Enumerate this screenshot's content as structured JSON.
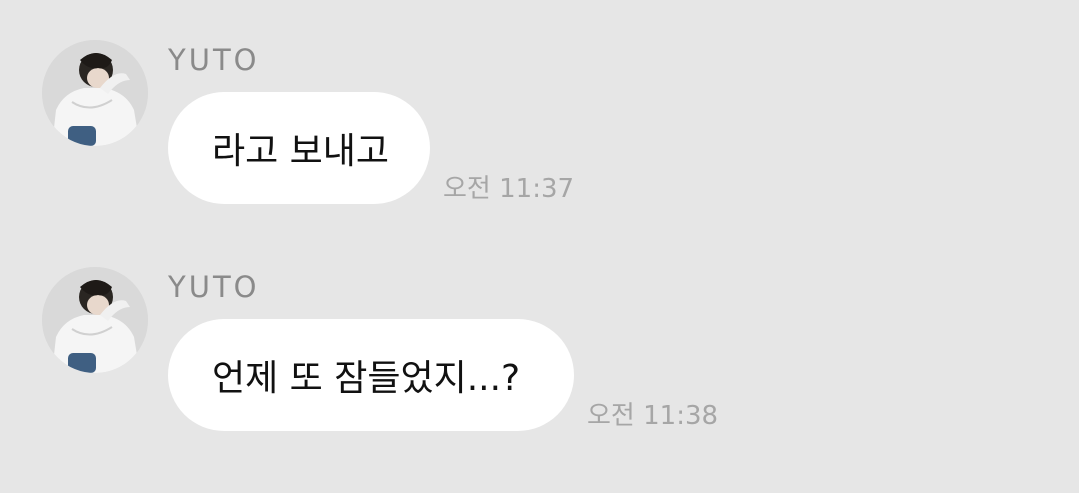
{
  "messages": [
    {
      "sender": "YUTO",
      "text": "라고 보내고",
      "time": "오전 11:37"
    },
    {
      "sender": "YUTO",
      "text": "언제 또 잠들었지...?",
      "time": "오전 11:38"
    }
  ],
  "colors": {
    "background": "#e6e6e6",
    "bubble": "#ffffff",
    "sender": "#8a8a8a",
    "time": "#a6a6a6"
  }
}
